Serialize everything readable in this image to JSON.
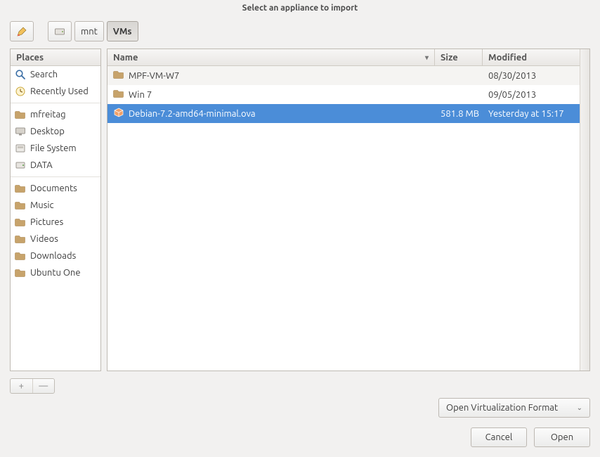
{
  "window": {
    "title": "Select an appliance to import"
  },
  "toolbar": {
    "path": [
      {
        "name": "pencil-icon",
        "interactable": true
      },
      {
        "name": "drive-icon",
        "interactable": true
      },
      {
        "name": "path-mnt",
        "label": "mnt",
        "interactable": true
      },
      {
        "name": "path-vms",
        "label": "VMs",
        "interactable": true,
        "active": true
      }
    ]
  },
  "places": {
    "header": "Places",
    "groups": [
      [
        {
          "name": "place-search",
          "icon": "search-icon",
          "label": "Search"
        },
        {
          "name": "place-recent",
          "icon": "clock-icon",
          "label": "Recently Used"
        }
      ],
      [
        {
          "name": "place-home",
          "icon": "folder-icon",
          "label": "mfreitag"
        },
        {
          "name": "place-desktop",
          "icon": "desktop-icon",
          "label": "Desktop"
        },
        {
          "name": "place-fs",
          "icon": "disk-icon",
          "label": "File System"
        },
        {
          "name": "place-data",
          "icon": "hdd-icon",
          "label": "DATA"
        }
      ],
      [
        {
          "name": "place-documents",
          "icon": "folder-icon",
          "label": "Documents"
        },
        {
          "name": "place-music",
          "icon": "folder-icon",
          "label": "Music"
        },
        {
          "name": "place-pictures",
          "icon": "folder-icon",
          "label": "Pictures"
        },
        {
          "name": "place-videos",
          "icon": "folder-icon",
          "label": "Videos"
        },
        {
          "name": "place-downloads",
          "icon": "folder-icon",
          "label": "Downloads"
        },
        {
          "name": "place-ubuntuone",
          "icon": "folder-icon",
          "label": "Ubuntu One"
        }
      ]
    ]
  },
  "files": {
    "columns": {
      "name": "Name",
      "size": "Size",
      "modified": "Modified"
    },
    "sort": {
      "column": "name",
      "dir": "asc"
    },
    "rows": [
      {
        "icon": "folder-icon",
        "name": "MPF-VM-W7",
        "size": "",
        "modified": "08/30/2013",
        "selected": false
      },
      {
        "icon": "folder-icon",
        "name": "Win 7",
        "size": "",
        "modified": "09/05/2013",
        "selected": false
      },
      {
        "icon": "package-icon",
        "name": "Debian-7.2-amd64-minimal.ova",
        "size": "581.8 MB",
        "modified": "Yesterday at 15:17",
        "selected": true
      }
    ]
  },
  "add_remove": {
    "add": "+",
    "remove": "—"
  },
  "filter": {
    "selected": "Open Virtualization Format"
  },
  "actions": {
    "cancel": "Cancel",
    "open": "Open"
  }
}
